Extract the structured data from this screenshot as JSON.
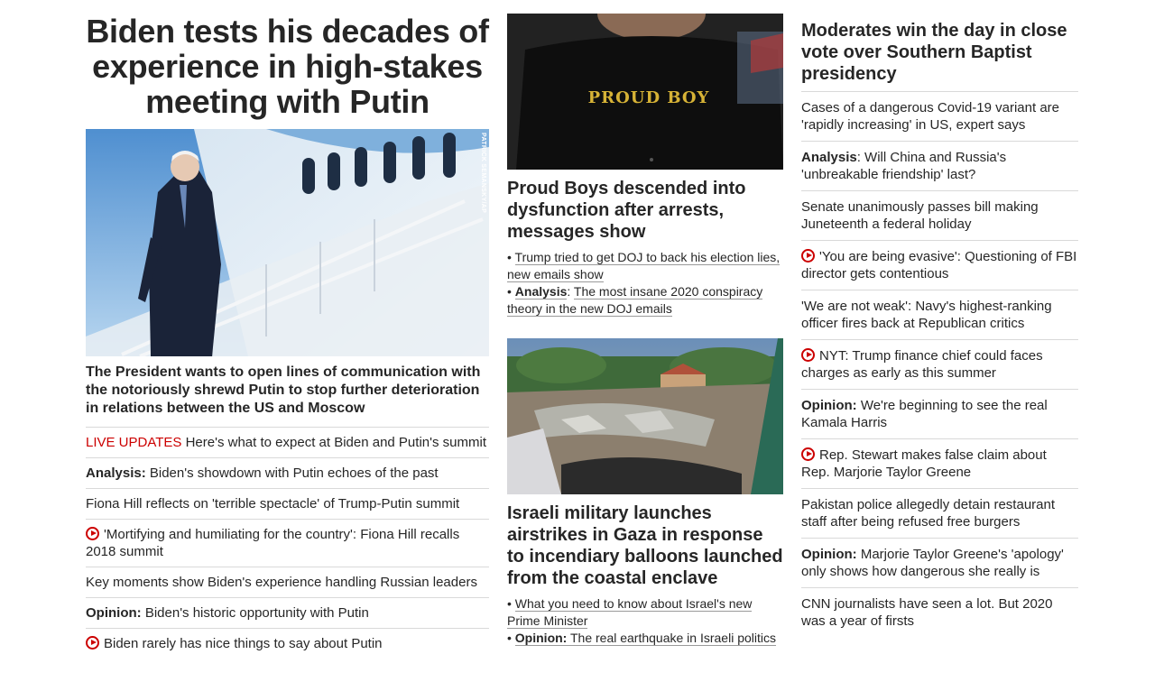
{
  "col1": {
    "hero_title": "Biden tests his decades of experience in high-stakes meeting with Putin",
    "photo_credit": "PATRICK SEMANSKY/AP",
    "hero_sub": "The President wants to open lines of communication with the notoriously shrewd Putin to stop further deterioration in relations between the US and Moscow",
    "items": [
      {
        "prefix": "LIVE UPDATES",
        "text": " Here's what to expect at Biden and Putin's summit"
      },
      {
        "prefix": "Analysis:",
        "text": " Biden's showdown with Putin echoes of the past"
      },
      {
        "text": "Fiona Hill reflects on 'terrible spectacle' of Trump-Putin summit"
      },
      {
        "video": true,
        "text": "'Mortifying and humiliating for the country': Fiona Hill recalls 2018 summit"
      },
      {
        "text": "Key moments show Biden's experience handling Russian leaders"
      },
      {
        "prefix": "Opinion:",
        "text": " Biden's historic opportunity with Putin"
      },
      {
        "video": true,
        "text": "Biden rarely has nice things to say about Putin"
      }
    ]
  },
  "col2": {
    "story1": {
      "shirt_text": "PROUD BOY",
      "title": "Proud Boys descended into dysfunction after arrests, messages show",
      "link1": "Trump tried to get DOJ to back his election lies, new emails show",
      "link2_prefix": "Analysis",
      "link2": "The most insane 2020 conspiracy theory in the new DOJ emails"
    },
    "story2": {
      "title": "Israeli military launches airstrikes in Gaza in response to incendiary balloons launched from the coastal enclave",
      "link1": "What you need to know about Israel's new Prime Minister",
      "link2_prefix": "Opinion:",
      "link2": " The real earthquake in Israeli politics"
    }
  },
  "col3": {
    "title": "Moderates win the day in close vote over Southern Baptist presidency",
    "items": [
      {
        "text": "Cases of a dangerous Covid-19 variant are 'rapidly increasing' in US, expert says"
      },
      {
        "prefix": "Analysis",
        "text": ": Will China and Russia's 'unbreakable friendship' last?"
      },
      {
        "text": "Senate unanimously passes bill making Juneteenth a federal holiday"
      },
      {
        "video": true,
        "text": "'You are being evasive': Questioning of FBI director gets contentious"
      },
      {
        "text": "'We are not weak': Navy's highest-ranking officer fires back at Republican critics"
      },
      {
        "video": true,
        "text": "NYT: Trump finance chief could faces charges as early as this summer"
      },
      {
        "prefix": "Opinion:",
        "text": " We're beginning to see the real Kamala Harris"
      },
      {
        "video": true,
        "text": "Rep. Stewart makes false claim about Rep. Marjorie Taylor Greene"
      },
      {
        "text": "Pakistan police allegedly detain restaurant staff after being refused free burgers"
      },
      {
        "prefix": "Opinion:",
        "text": " Marjorie Taylor Greene's 'apology' only shows how dangerous she really is"
      },
      {
        "text": "CNN journalists have seen a lot. But 2020 was a year of firsts"
      }
    ]
  },
  "colors": {
    "text": "#262626",
    "live_red": "#cc0000",
    "divider": "#d9d9d9"
  }
}
